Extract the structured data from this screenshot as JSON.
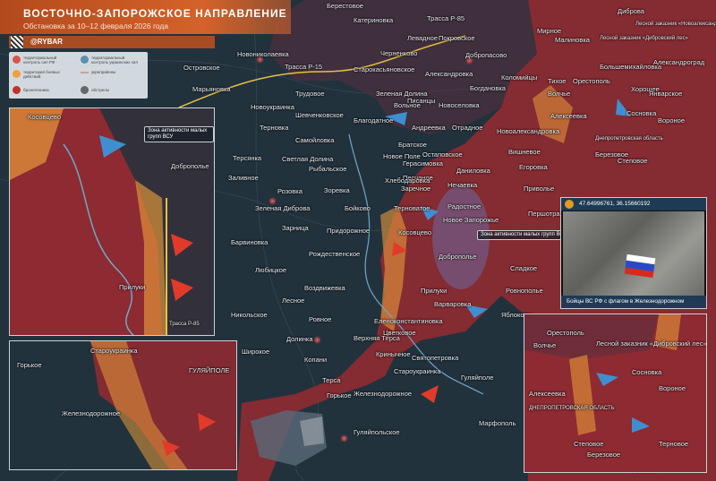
{
  "header": {
    "title": "ВОСТОЧНО-ЗАПОРОЖСКОЕ НАПРАВЛЕНИЕ",
    "subtitle": "Обстановка за 10–12 февраля 2026 года",
    "brand": "@RYBAR"
  },
  "legend": {
    "items": [
      {
        "label": "территориальный контроль сил РФ",
        "color": "#d9534f"
      },
      {
        "label": "территориальный контроль украинских сил",
        "color": "#5a8fb0"
      },
      {
        "label": "территория боевых действий",
        "color": "#f0a040"
      },
      {
        "label": "укрепрайоны",
        "color": "#c8a0a0"
      },
      {
        "label": "бронетехника",
        "color": "#c0302a"
      },
      {
        "label": "обстрелы",
        "color": "#666666"
      }
    ]
  },
  "colors": {
    "ru_control": "#8e2a31",
    "ua_territory": "#22323d",
    "contested": "#e89a3a",
    "header": "#c9552a",
    "arrows_ua": "#3f8fd0",
    "arrows_ru": "#e23a2a"
  },
  "photo": {
    "coordinates": "47.64996761, 36.15660192",
    "caption": "Бойцы ВС РФ с флагом в Железнодорожном",
    "flag_colors": [
      "#ffffff",
      "#2b49c4",
      "#d52b1e"
    ]
  },
  "zone_label": "Зона активности малых групп ВСУ",
  "places": [
    "Берестовое",
    "Катериновка",
    "Трасса Р-85",
    "Диброва",
    "Лесной заказник «Новоалександровский лес»",
    "Лесной заказник «Дибровский лес»",
    "Левадное",
    "Покровское",
    "Мирное",
    "Малиновка",
    "Новониколаевка",
    "Островское",
    "Трасса Р-15",
    "Черненково",
    "Добропасово",
    "Большемихайловка",
    "Александроград",
    "Марьяновка",
    "Старокасьяновское",
    "Александровка",
    "Коломийцы",
    "Тихое",
    "Орестополь",
    "Хорошее",
    "Трудовое",
    "Зеленая Долина",
    "Писанцы",
    "Богдановка",
    "Январское",
    "Новоукраинка",
    "Вольное",
    "Новоселовка",
    "Волчье",
    "Сосновка",
    "Шевченковское",
    "Благодатное",
    "Андреевка",
    "Отрадное",
    "Алексеевка",
    "Вороное",
    "Терновка",
    "Новоалександровка",
    "Днепропетровская область",
    "Самойловка",
    "Братское",
    "Остаповское",
    "Вишневое",
    "Березовое",
    "Степовое",
    "Терсянка",
    "Светлая Долина",
    "Новое Поле",
    "Герасимовка",
    "Песчаное",
    "Даниловка",
    "Егоровка",
    "Заливное",
    "Рыбальское",
    "Хлебодаровка",
    "Заречное",
    "Нечаевка",
    "Приволье",
    "Розовка",
    "Зоревка",
    "Зеленая Диброва",
    "Бойково",
    "Терноватое",
    "Радостное",
    "Новое Запорожье",
    "Зарница",
    "Придорожное",
    "Косовцево",
    "Першотравневое",
    "Барвиновка",
    "Рождественское",
    "Доброполье",
    "Сладкое",
    "Любицкое",
    "Воздвижевка",
    "Прилуки",
    "Лесное",
    "Варваровка",
    "Ровнополье",
    "Никольское",
    "Ровное",
    "Еленоконстантиновка",
    "Яблоково",
    "Долинка",
    "Верхняя Терса",
    "Цветковое",
    "Широкое",
    "Копани",
    "Кринычное",
    "Святопетровка",
    "Терса",
    "Гуляйполе",
    "Горькое",
    "Староукраинка",
    "Железнодорожное",
    "Гуляйпольское",
    "Марфополь",
    "Терновое"
  ]
}
